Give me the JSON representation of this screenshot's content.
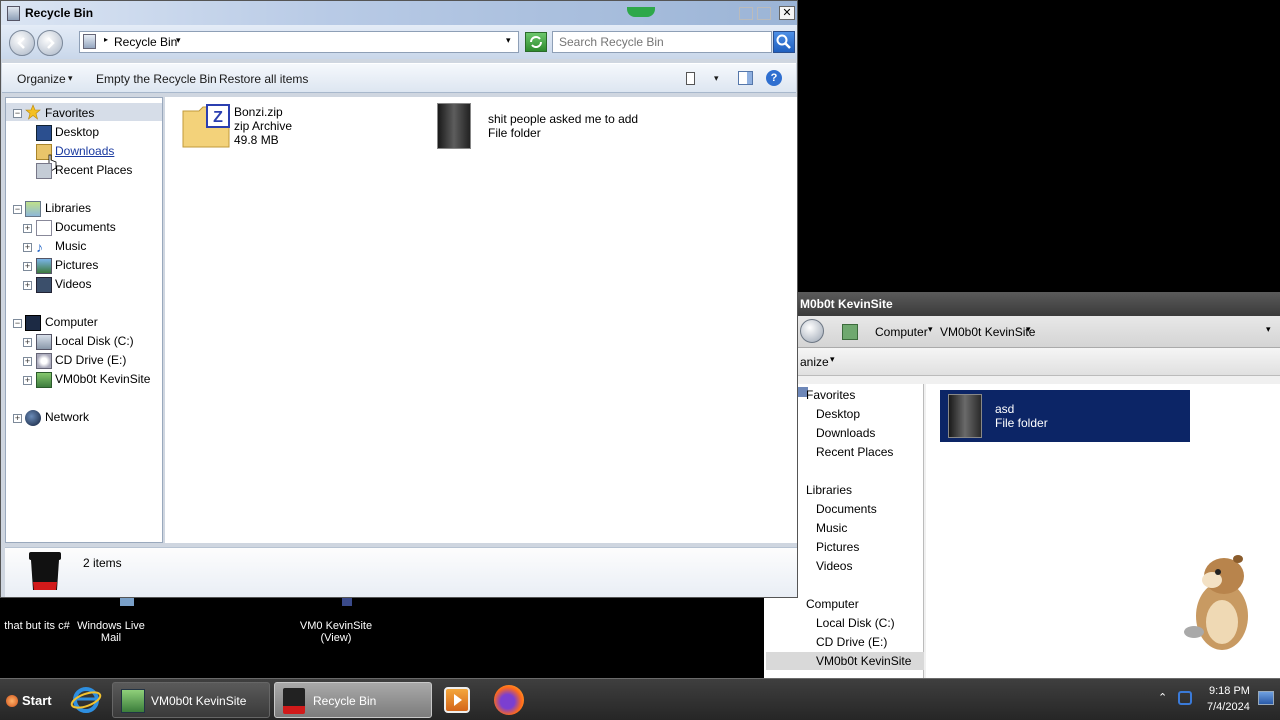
{
  "desktop": {
    "icons": [
      {
        "label": "that but its c#"
      },
      {
        "label": "Windows Live Mail"
      },
      {
        "label": "VM0 KevinSite (View)"
      }
    ]
  },
  "background_window": {
    "title": "M0b0t KevinSite",
    "breadcrumb": [
      "Computer",
      "VM0b0t KevinSite"
    ],
    "organize_label": "anize",
    "nav": {
      "favorites": "Favorites",
      "desktop": "Desktop",
      "downloads": "Downloads",
      "recent": "Recent Places",
      "libraries": "Libraries",
      "documents": "Documents",
      "music": "Music",
      "pictures": "Pictures",
      "videos": "Videos",
      "computer": "Computer",
      "local_disk": "Local Disk (C:)",
      "cd_drive": "CD Drive (E:)",
      "vm_site": "VM0b0t KevinSite"
    },
    "selected_item": {
      "name": "asd",
      "type": "File folder"
    }
  },
  "window": {
    "title": "Recycle Bin",
    "address": "Recycle Bin",
    "search_placeholder": "Search Recycle Bin",
    "toolbar": {
      "organize": "Organize",
      "empty": "Empty the Recycle Bin",
      "restore": "Restore all items"
    },
    "nav": {
      "favorites": "Favorites",
      "desktop": "Desktop",
      "downloads": "Downloads",
      "recent": "Recent Places",
      "libraries": "Libraries",
      "documents": "Documents",
      "music": "Music",
      "pictures": "Pictures",
      "videos": "Videos",
      "computer": "Computer",
      "local_disk": "Local Disk (C:)",
      "cd_drive": "CD Drive (E:)",
      "vm_site": "VM0b0t KevinSite",
      "network": "Network"
    },
    "items": [
      {
        "name": "Bonzi.zip",
        "type": "zip Archive",
        "size": "49.8 MB"
      },
      {
        "name": "shit people asked me to add",
        "type": "File folder"
      }
    ],
    "details": {
      "count": "2 items"
    }
  },
  "taskbar": {
    "start": "Start",
    "buttons": [
      {
        "label": "VM0b0t KevinSite"
      },
      {
        "label": "Recycle Bin"
      }
    ],
    "clock": {
      "time": "9:18 PM",
      "date": "7/4/2024"
    }
  }
}
